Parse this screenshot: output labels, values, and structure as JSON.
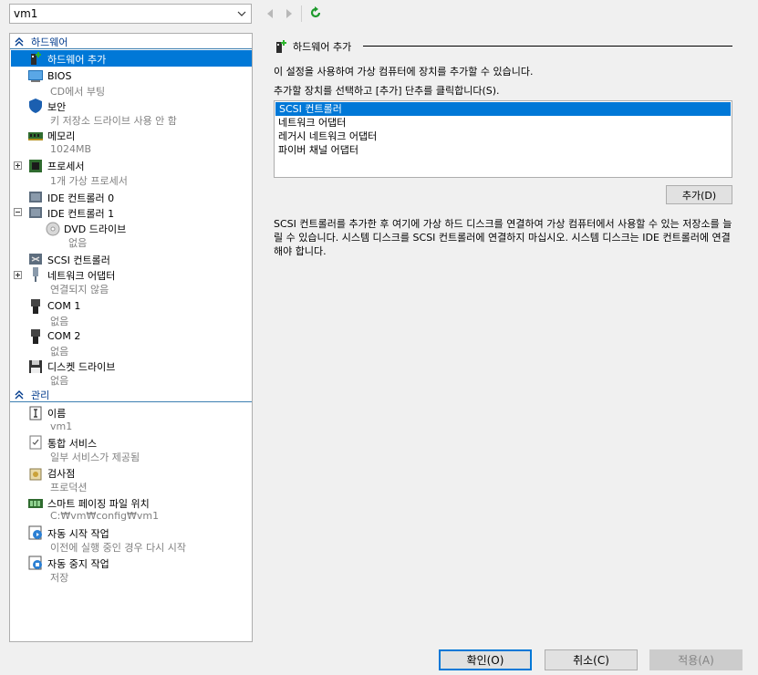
{
  "vm_selector": {
    "value": "vm1"
  },
  "toolbar": {
    "back_icon": "back-arrow-icon",
    "forward_icon": "forward-arrow-icon",
    "refresh_icon": "refresh-icon"
  },
  "tree": {
    "hardware_section": "하드웨어",
    "management_section": "관리",
    "hardware_items": [
      {
        "label": "하드웨어 추가",
        "sub": ""
      },
      {
        "label": "BIOS",
        "sub": "CD에서 부팅"
      },
      {
        "label": "보안",
        "sub": "키 저장소 드라이브 사용 안 함"
      },
      {
        "label": "메모리",
        "sub": "1024MB"
      },
      {
        "label": "프로세서",
        "sub": "1개 가상 프로세서"
      },
      {
        "label": "IDE 컨트롤러 0",
        "sub": ""
      },
      {
        "label": "IDE 컨트롤러 1",
        "sub": ""
      },
      {
        "label": "DVD 드라이브",
        "sub": "없음"
      },
      {
        "label": "SCSI 컨트롤러",
        "sub": ""
      },
      {
        "label": "네트워크 어댑터",
        "sub": "연결되지 않음"
      },
      {
        "label": "COM 1",
        "sub": "없음"
      },
      {
        "label": "COM 2",
        "sub": "없음"
      },
      {
        "label": "디스켓 드라이브",
        "sub": "없음"
      }
    ],
    "management_items": [
      {
        "label": "이름",
        "sub": "vm1"
      },
      {
        "label": "통합 서비스",
        "sub": "일부 서비스가 제공됨"
      },
      {
        "label": "검사점",
        "sub": "프로덕션"
      },
      {
        "label": "스마트 페이징 파일 위치",
        "sub": "C:₩vm₩config₩vm1"
      },
      {
        "label": "자동 시작 작업",
        "sub": "이전에 실행 중인 경우 다시 시작"
      },
      {
        "label": "자동 중지 작업",
        "sub": "저장"
      }
    ]
  },
  "panel": {
    "title": "하드웨어 추가",
    "desc1": "이 설정을 사용하여 가상 컴퓨터에 장치를 추가할 수 있습니다.",
    "desc2": "추가할 장치를 선택하고 [추가] 단추를 클릭합니다(S).",
    "devices": [
      "SCSI 컨트롤러",
      "네트워크 어댑터",
      "레거시 네트워크 어댑터",
      "파이버 채널 어댑터"
    ],
    "selected_device": "SCSI 컨트롤러",
    "add_button": "추가(D)",
    "info": "SCSI 컨트롤러를 추가한 후 여기에 가상 하드 디스크를 연결하여 가상 컴퓨터에서 사용할 수 있는 저장소를 늘릴 수 있습니다. 시스템 디스크를 SCSI 컨트롤러에 연결하지 마십시오. 시스템 디스크는 IDE 컨트롤러에 연결해야 합니다."
  },
  "buttons": {
    "ok": "확인(O)",
    "cancel": "취소(C)",
    "apply": "적용(A)"
  },
  "colors": {
    "selection": "#0078d7",
    "section_text": "#003a8c",
    "disabled_text": "#838383"
  }
}
